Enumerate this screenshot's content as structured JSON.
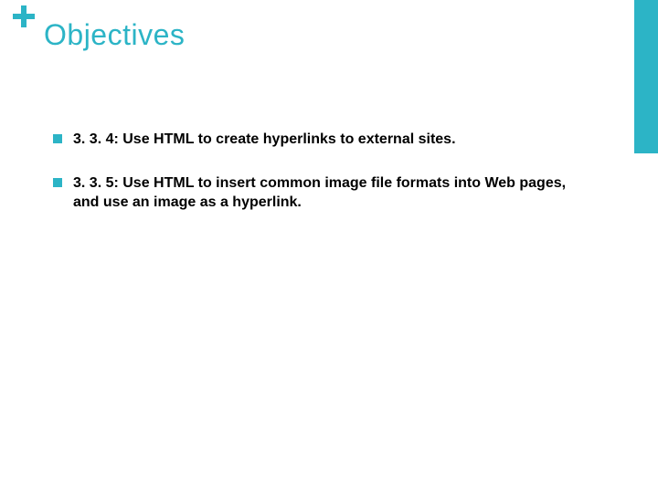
{
  "colors": {
    "accent": "#2cb4c6",
    "text": "#000000",
    "bg": "#ffffff"
  },
  "header": {
    "plus_icon": "plus",
    "title": "Objectives"
  },
  "body": {
    "items": [
      {
        "text": "3. 3. 4: Use HTML to create hyperlinks to external sites."
      },
      {
        "text": "3. 3. 5: Use HTML to insert common image file formats into Web pages, and use an image as a hyperlink."
      }
    ]
  }
}
